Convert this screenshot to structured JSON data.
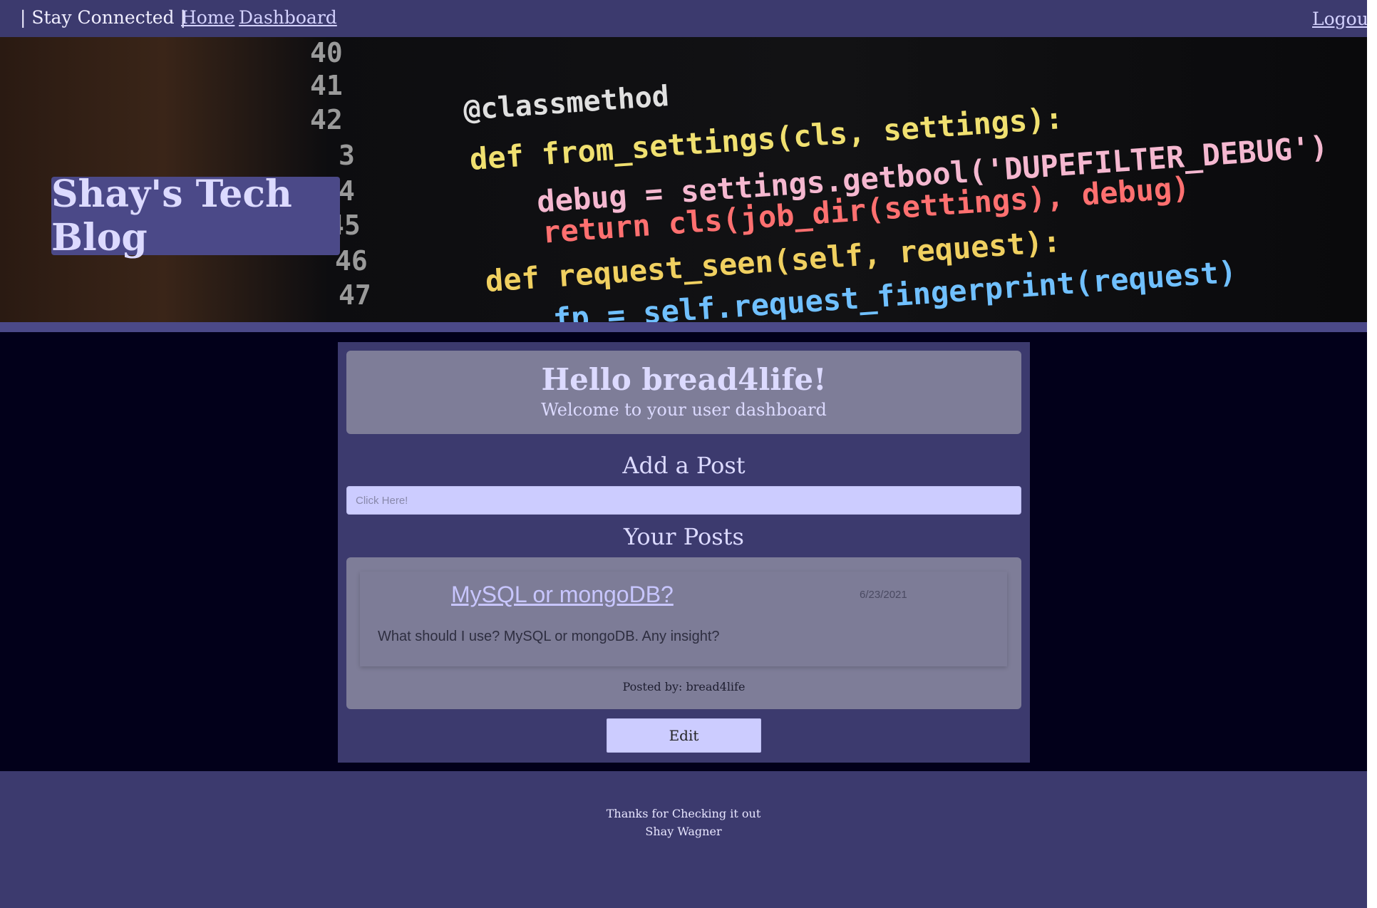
{
  "header": {
    "brand": "| Stay Connected |",
    "nav": [
      {
        "label": "Home"
      },
      {
        "label": "Dashboard"
      }
    ],
    "logout_label": "Logout"
  },
  "hero": {
    "title": "Shay's Tech Blog",
    "code_line_numbers": [
      "40",
      "41",
      "42",
      "3",
      "4",
      "45",
      "46",
      "47"
    ],
    "code_lines": [
      "@classmethod",
      "def from_settings(cls, settings):",
      "debug = settings.getbool('DUPEFILTER_DEBUG')",
      "return cls(job_dir(settings), debug)",
      "def request_seen(self, request):",
      "fp = self.request_fingerprint(request)"
    ]
  },
  "dashboard": {
    "greeting": "Hello bread4life!",
    "subtitle": "Welcome to your user dashboard",
    "add_post_heading": "Add a Post",
    "add_post_placeholder": "Click Here!",
    "your_posts_heading": "Your Posts",
    "posts": [
      {
        "title": "MySQL or mongoDB?",
        "date": "6/23/2021",
        "body": "What should I use? MySQL or mongoDB. Any insight?",
        "posted_by": "Posted by: bread4life"
      }
    ],
    "edit_label": "Edit"
  },
  "footer": {
    "line1": "Thanks for Checking it out",
    "line2": "Shay Wagner"
  },
  "colors": {
    "nav_bg": "#3c3a6e",
    "main_bg": "#02001a",
    "card_bg": "#7e7d98",
    "accent_light": "#ccccff",
    "title_box": "#4b4988"
  }
}
